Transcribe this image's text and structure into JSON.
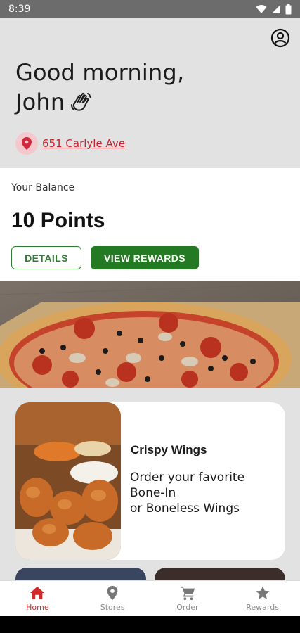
{
  "status_bar": {
    "time": "8:39"
  },
  "header": {
    "greeting_line1": "Good morning,",
    "greeting_line2": "John",
    "location": "651 Carlyle Ave"
  },
  "balance": {
    "label": "Your Balance",
    "points": "10 Points",
    "details_label": "DETAILS",
    "rewards_label": "VIEW REWARDS"
  },
  "promo": {
    "title": "Crispy Wings",
    "text": "Order your favorite\nBone-In\nor Boneless Wings"
  },
  "nav": {
    "items": [
      {
        "label": "Home",
        "icon": "home-icon",
        "active": true
      },
      {
        "label": "Stores",
        "icon": "map-pin-icon",
        "active": false
      },
      {
        "label": "Order",
        "icon": "cart-icon",
        "active": false
      },
      {
        "label": "Rewards",
        "icon": "star-icon",
        "active": false
      }
    ]
  },
  "colors": {
    "accent_red": "#d22a2a",
    "link_red": "#c9202c",
    "accent_green": "#247a22",
    "header_bg": "#e2e2e2"
  }
}
